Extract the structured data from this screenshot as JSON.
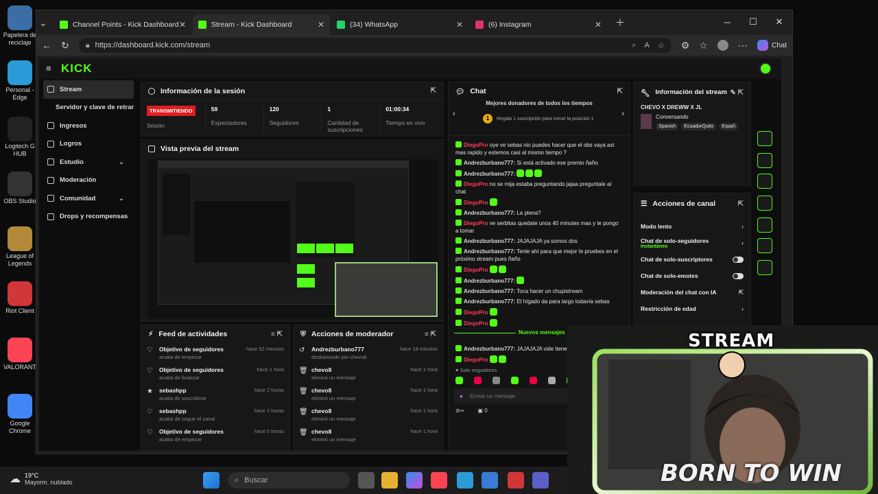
{
  "desktop": {
    "icons": [
      {
        "label": "Papelera de reciclaje",
        "color": "#3a6ea5"
      },
      {
        "label": "Personal - Edge",
        "color": "#2a9bd8"
      },
      {
        "label": "Logitech G HUB",
        "color": "#222"
      },
      {
        "label": "OBS Studio",
        "color": "#333"
      },
      {
        "label": "League of Legends",
        "color": "#b28a3a"
      },
      {
        "label": "Riot Client",
        "color": "#d13639"
      },
      {
        "label": "VALORANT",
        "color": "#fa4454"
      },
      {
        "label": "Google Chrome",
        "color": "#4285f4"
      }
    ]
  },
  "browser": {
    "tabs": [
      {
        "title": "Channel Points - Kick Dashboard",
        "icon": "kick-icon",
        "color": "#53fc18"
      },
      {
        "title": "Stream - Kick Dashboard",
        "icon": "kick-icon",
        "color": "#53fc18"
      },
      {
        "title": "(34) WhatsApp",
        "icon": "whatsapp-icon",
        "color": "#25d366"
      },
      {
        "title": "(6) Instagram",
        "icon": "instagram-icon",
        "color": "#e1306c"
      }
    ],
    "url": "https://dashboard.kick.com/stream",
    "chat_button": "Chat"
  },
  "kick": {
    "logo": "KICK",
    "sidebar": [
      {
        "label": "Stream",
        "active": true
      },
      {
        "label": "Servidor y clave de retransm",
        "active": false
      },
      {
        "label": "Ingresos",
        "active": false
      },
      {
        "label": "Logros",
        "active": false
      },
      {
        "label": "Estudio",
        "active": false,
        "chevron": true
      },
      {
        "label": "Moderación",
        "active": false
      },
      {
        "label": "Comunidad",
        "active": false,
        "chevron": true
      },
      {
        "label": "Drops y recompensas",
        "active": false
      }
    ],
    "session": {
      "title": "Información de la sesión",
      "status": "TRANSMITIENDO",
      "status_label": "Sesión",
      "stats": [
        {
          "value": "59",
          "label": "Espectadores"
        },
        {
          "value": "120",
          "label": "Seguidores"
        },
        {
          "value": "1",
          "label": "Cantidad de suscripciones"
        },
        {
          "value": "01:00:34",
          "label": "Tiempo en vivo"
        }
      ]
    },
    "preview": {
      "title": "Vista previa del stream"
    },
    "feed": {
      "title": "Feed de actividades",
      "items": [
        {
          "icon": "heart-icon",
          "title": "Objetivo de seguidores",
          "sub": "acaba de empezar",
          "time": "hace 52 minutos"
        },
        {
          "icon": "heart-icon",
          "title": "Objetivo de seguidores",
          "sub": "acaba de finalizar",
          "time": "hace 1 hora"
        },
        {
          "icon": "star-icon",
          "title": "sebashpp",
          "sub": "acaba de suscribirse",
          "time": "hace 2 horas"
        },
        {
          "icon": "heart-icon",
          "title": "sebashpp",
          "sub": "acaba de seguir el canal",
          "time": "hace 2 horas"
        },
        {
          "icon": "heart-icon",
          "title": "Objetivo de seguidores",
          "sub": "acaba de empezar",
          "time": "hace 5 horas"
        }
      ]
    },
    "modactions": {
      "title": "Acciones de moderador",
      "items": [
        {
          "icon": "undo-icon",
          "title": "Andrezburbano777",
          "sub": "desbaneado por chevo8",
          "time": "hace 18 minutos"
        },
        {
          "icon": "trash-icon",
          "title": "chevo8",
          "sub": "eliminó un mensaje",
          "time": "hace 1 hora"
        },
        {
          "icon": "trash-icon",
          "title": "chevo8",
          "sub": "eliminó un mensaje",
          "time": "hace 1 hora"
        },
        {
          "icon": "trash-icon",
          "title": "chevo8",
          "sub": "eliminó un mensaje",
          "time": "hace 1 hora"
        },
        {
          "icon": "trash-icon",
          "title": "chevo8",
          "sub": "eliminó un mensaje",
          "time": "hace 1 hora"
        }
      ]
    },
    "chat": {
      "title": "Chat",
      "top_donors": "Mejores donadores de todos los tiempos",
      "gift_text": "Regala 1 suscripción para tomar la posición 1",
      "messages": [
        {
          "user": "DiegoPro",
          "red": true,
          "text": "oye ve sebas nio puedes hacer que el obs vaya asi mas rapido y estemos casi al mismo tiempo ?"
        },
        {
          "user": "Andrezburbano777:",
          "red": false,
          "text": "Si está activado ese premio ñaño"
        },
        {
          "user": "Andrezburbano777:",
          "red": false,
          "text": "",
          "emotes": 3
        },
        {
          "user": "DiegoPro",
          "red": true,
          "text": "no se mija estaba preguntando jajaa preguntale al chat"
        },
        {
          "user": "DiegoPro",
          "red": true,
          "text": "",
          "emotes": 1
        },
        {
          "user": "Andrezburbano777:",
          "red": false,
          "text": "La plena?"
        },
        {
          "user": "DiegoPro",
          "red": true,
          "text": "ve serbitas quedate unos 40 minutes mas y te pongo a tomar"
        },
        {
          "user": "Andrezburbano777:",
          "red": false,
          "text": "JAJAJAJA ya somos dos"
        },
        {
          "user": "Andrezburbano777:",
          "red": false,
          "text": "Tenle ahí para que mejor le pruebes en el próximo stream pues ñaño"
        },
        {
          "user": "DiegoPro",
          "red": true,
          "text": "",
          "emotes": 2
        },
        {
          "user": "Andrezburbano777:",
          "red": false,
          "text": "",
          "emotes": 1
        },
        {
          "user": "Andrezburbano777:",
          "red": false,
          "text": "Toca hacer un chupistream"
        },
        {
          "user": "Andrezburbano777:",
          "red": false,
          "text": "El hígado da para largo todavía sebas"
        },
        {
          "user": "DiegoPro",
          "red": true,
          "text": "",
          "emotes": 1
        },
        {
          "user": "DiegoPro",
          "red": true,
          "text": "",
          "emotes": 1
        }
      ],
      "new_messages": "Nuevos mensajes",
      "after_messages": [
        {
          "user": "Andrezburbano777:",
          "red": false,
          "text": "JAJAJAJA vide tienen ese"
        },
        {
          "user": "DiegoPro",
          "red": true,
          "text": "",
          "emotes": 2
        }
      ],
      "followers_only": "Solo seguidores",
      "input_placeholder": "Enviar un mensaje",
      "footer_count": "0"
    },
    "streaminfo": {
      "title": "Información del stream",
      "stream_title": "CHEVO X DREWW X JL",
      "category": "Conversando",
      "tags": [
        "Spanish",
        "EcuadorQuito",
        "Españ"
      ]
    },
    "channel_actions": {
      "title": "Acciones de canal",
      "items": [
        {
          "label": "Modo lento",
          "control": "chevron"
        },
        {
          "label": "Chat de solo-seguidores",
          "sub": "Instantáneo",
          "control": "chevron"
        },
        {
          "label": "Chat de solo-suscriptores",
          "control": "toggle"
        },
        {
          "label": "Chat de solo-emotes",
          "control": "toggle"
        },
        {
          "label": "Moderación del chat con IA",
          "control": "external"
        },
        {
          "label": "Restricción de edad",
          "control": "chevron"
        }
      ]
    }
  },
  "taskbar": {
    "weather_temp": "19°C",
    "weather_desc": "Mayorm. nublado",
    "search_placeholder": "Buscar"
  },
  "overlay": {
    "top_text": "STREAM",
    "bottom_text": "BORN TO WIN"
  }
}
